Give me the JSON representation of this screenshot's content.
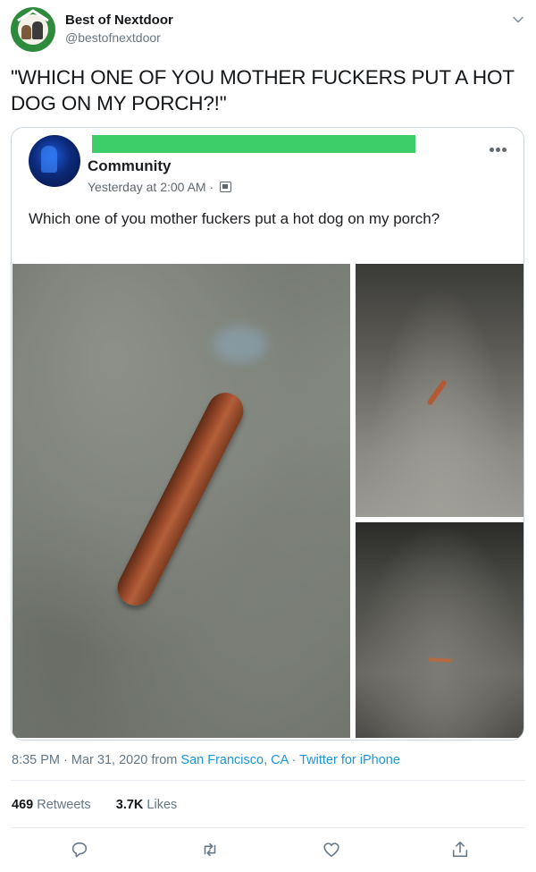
{
  "header": {
    "name": "Best of Nextdoor",
    "handle": "@bestofnextdoor"
  },
  "tweet": {
    "text": "\"WHICH ONE OF YOU MOTHER FUCKERS PUT A HOT DOG ON MY PORCH?!\""
  },
  "embedded_post": {
    "group_name": "Community",
    "meta": "Yesterday at 2:00 AM ·",
    "text": "Which one of you mother fuckers put a hot dog on my porch?"
  },
  "footer": {
    "time": "8:35 PM",
    "date": "Mar 31, 2020",
    "from_label": "from",
    "location": "San Francisco, CA",
    "client": "Twitter for iPhone"
  },
  "stats": {
    "retweets_count": "469",
    "retweets_label": "Retweets",
    "likes_count": "3.7K",
    "likes_label": "Likes"
  },
  "colors": {
    "link": "#1b95e0",
    "muted": "#657786",
    "redaction": "#3dce6a"
  },
  "icons": [
    "chevron-down-icon",
    "more-icon",
    "reply-icon",
    "retweet-icon",
    "like-icon",
    "share-icon"
  ]
}
